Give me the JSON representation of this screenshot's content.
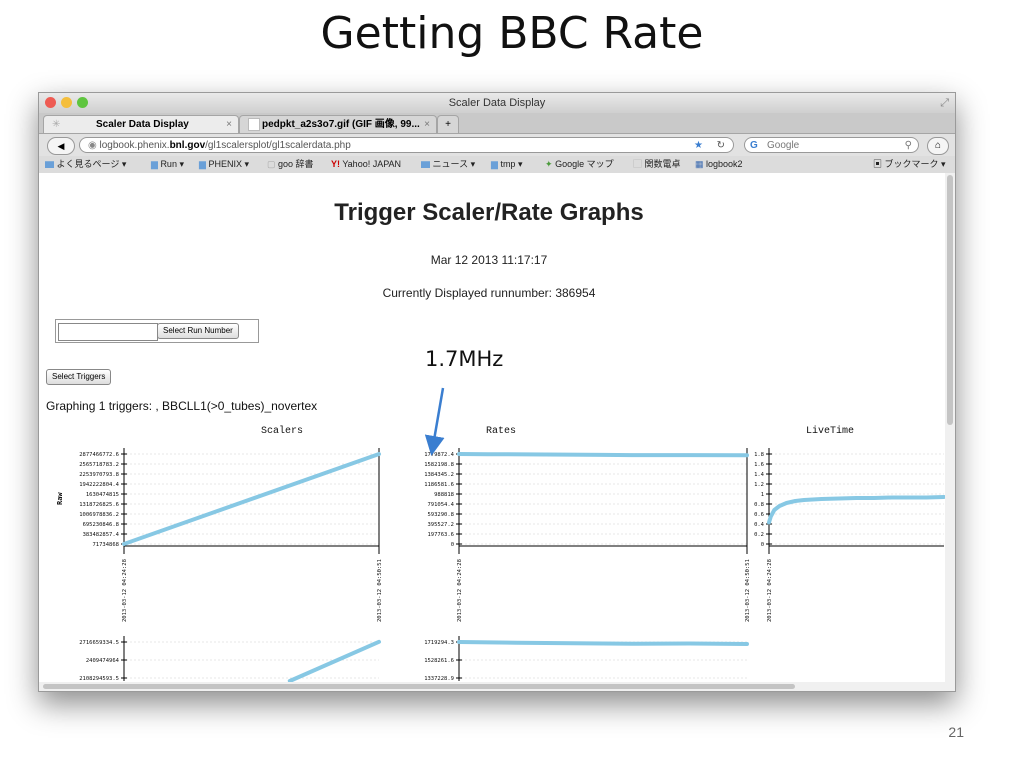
{
  "slide": {
    "title": "Getting BBC Rate",
    "annotation": "1.7MHz",
    "page_number": "21"
  },
  "window": {
    "title": "Scaler Data Display"
  },
  "tabs": [
    {
      "label": "Scaler Data Display"
    },
    {
      "label": "pedpkt_a2s3o7.gif (GIF 画像, 99..."
    }
  ],
  "nav": {
    "url_host": "logbook.phenix.",
    "url_domain": "bnl.gov",
    "url_path": "/gl1scalersplot/gl1scalerdata.php",
    "search_placeholder": "Google"
  },
  "bookmarks": [
    {
      "label": "よく見るページ ▾"
    },
    {
      "label": "Run ▾"
    },
    {
      "label": "PHENIX ▾"
    },
    {
      "label": "goo 辞書"
    },
    {
      "label": "Yahoo! JAPAN"
    },
    {
      "label": "ニュース ▾"
    },
    {
      "label": "tmp ▾"
    },
    {
      "label": "Google マップ"
    },
    {
      "label": "関数電卓"
    },
    {
      "label": "logbook2"
    },
    {
      "label": "ブックマーク ▾"
    }
  ],
  "page": {
    "heading": "Trigger Scaler/Rate Graphs",
    "date": "Mar 12 2013 11:17:17",
    "runnumber_text": "Currently Displayed runnumber: 386954",
    "run_input_value": "",
    "select_run_label": "Select Run Number",
    "select_triggers_label": "Select Triggers",
    "graphing_text": "Graphing 1 triggers: , BBCLL1(>0_tubes)_novertex"
  },
  "colors": {
    "series": "#87c8e4",
    "accent": "#3a7ed0"
  },
  "chart_data": [
    {
      "type": "line",
      "title": "Scalers",
      "ylabel": "Raw",
      "y_ticks": [
        "2877466772.6",
        "2565718783.2",
        "2253970793.8",
        "1942222804.4",
        "1630474815",
        "1318726825.6",
        "1006978836.2",
        "695230846.8",
        "383482857.4",
        "71734868"
      ],
      "x_ticks": [
        "2013-03-12 04:24:28",
        "2013-03-12 04:50:51"
      ],
      "ylim": [
        71734868,
        2877466772.6
      ],
      "series": [
        {
          "x": [
            0,
            1
          ],
          "y": [
            71734868,
            2877466772.6
          ]
        }
      ]
    },
    {
      "type": "line",
      "title": "Rates",
      "y_ticks": [
        "1779872.4",
        "1582198.8",
        "1384345.2",
        "1186581.6",
        "988818",
        "791054.4",
        "593290.8",
        "395527.2",
        "197763.6",
        "0"
      ],
      "x_ticks": [
        "2013-03-12 04:24:28",
        "2013-03-12 04:50:51"
      ],
      "ylim": [
        0,
        1779872.4
      ],
      "series": [
        {
          "x": [
            0,
            0.1,
            0.3,
            0.5,
            0.6,
            0.8,
            1
          ],
          "y": [
            1779000,
            1776000,
            1770000,
            1762000,
            1758000,
            1758000,
            1755000
          ]
        }
      ]
    },
    {
      "type": "line",
      "title": "LiveTime",
      "y_ticks": [
        "1.8",
        "1.6",
        "1.4",
        "1.2",
        "1",
        "0.8",
        "0.6",
        "0.4",
        "0.2",
        "0"
      ],
      "x_ticks": [
        "2013-03-12 04:24:28"
      ],
      "ylim": [
        0,
        1.8
      ],
      "series": [
        {
          "x": [
            0,
            0.01,
            0.03,
            0.06,
            0.1,
            0.15,
            0.2,
            0.3,
            0.4,
            0.5,
            0.6,
            0.7,
            0.8,
            0.9,
            1
          ],
          "y": [
            0.43,
            0.55,
            0.68,
            0.76,
            0.82,
            0.86,
            0.88,
            0.9,
            0.91,
            0.92,
            0.92,
            0.93,
            0.93,
            0.93,
            0.94
          ]
        }
      ]
    },
    {
      "type": "line",
      "y_ticks": [
        "2716659334.5",
        "2409474964",
        "2108294593.5"
      ],
      "ylim": [
        2108294593.5,
        2716659334.5
      ],
      "series": [
        {
          "x": [
            0.65,
            1
          ],
          "y": [
            1900000000,
            2720000000
          ]
        }
      ]
    },
    {
      "type": "line",
      "y_ticks": [
        "1719294.3",
        "1528261.6",
        "1337228.9"
      ],
      "ylim": [
        1337228.9,
        1719294.3
      ],
      "series": [
        {
          "x": [
            0,
            0.2,
            0.4,
            0.6,
            0.8,
            1
          ],
          "y": [
            1719294.3,
            1712000,
            1705000,
            1700000,
            1703000,
            1698000
          ]
        }
      ]
    }
  ]
}
